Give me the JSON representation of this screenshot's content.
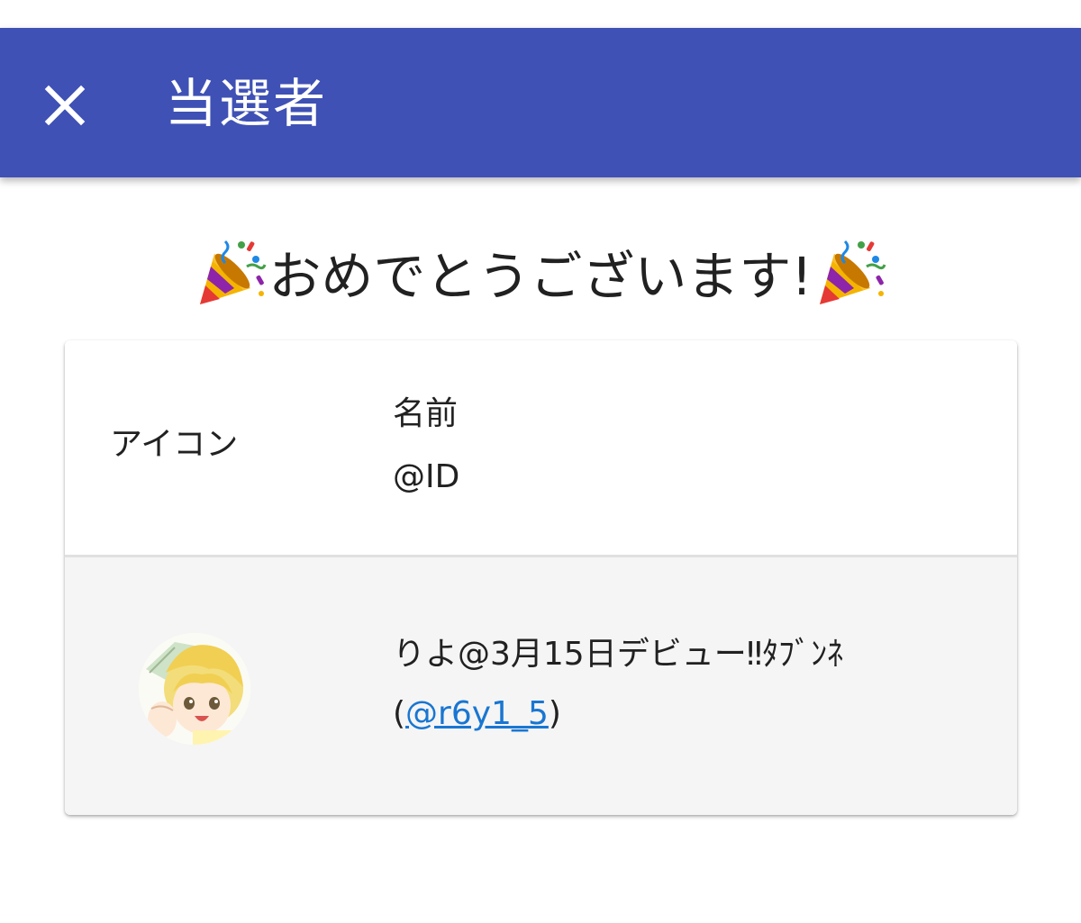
{
  "app_bar": {
    "title": "当選者",
    "close_icon": "close-icon",
    "background": "#3f51b5"
  },
  "headline": {
    "text": "おめでとうございます!",
    "icon": "party-popper-icon"
  },
  "table": {
    "headers": {
      "icon": "アイコン",
      "name": "名前",
      "id": "@ID"
    },
    "rows": [
      {
        "avatar": "user-avatar",
        "name": "りよ@3月15日デビュー‼ﾀﾌﾞﾝﾈ",
        "id_open": "(",
        "id": "@r6y1_5",
        "id_close": ")"
      }
    ]
  },
  "colors": {
    "link": "#1976d2",
    "row_background": "#f5f5f5"
  }
}
